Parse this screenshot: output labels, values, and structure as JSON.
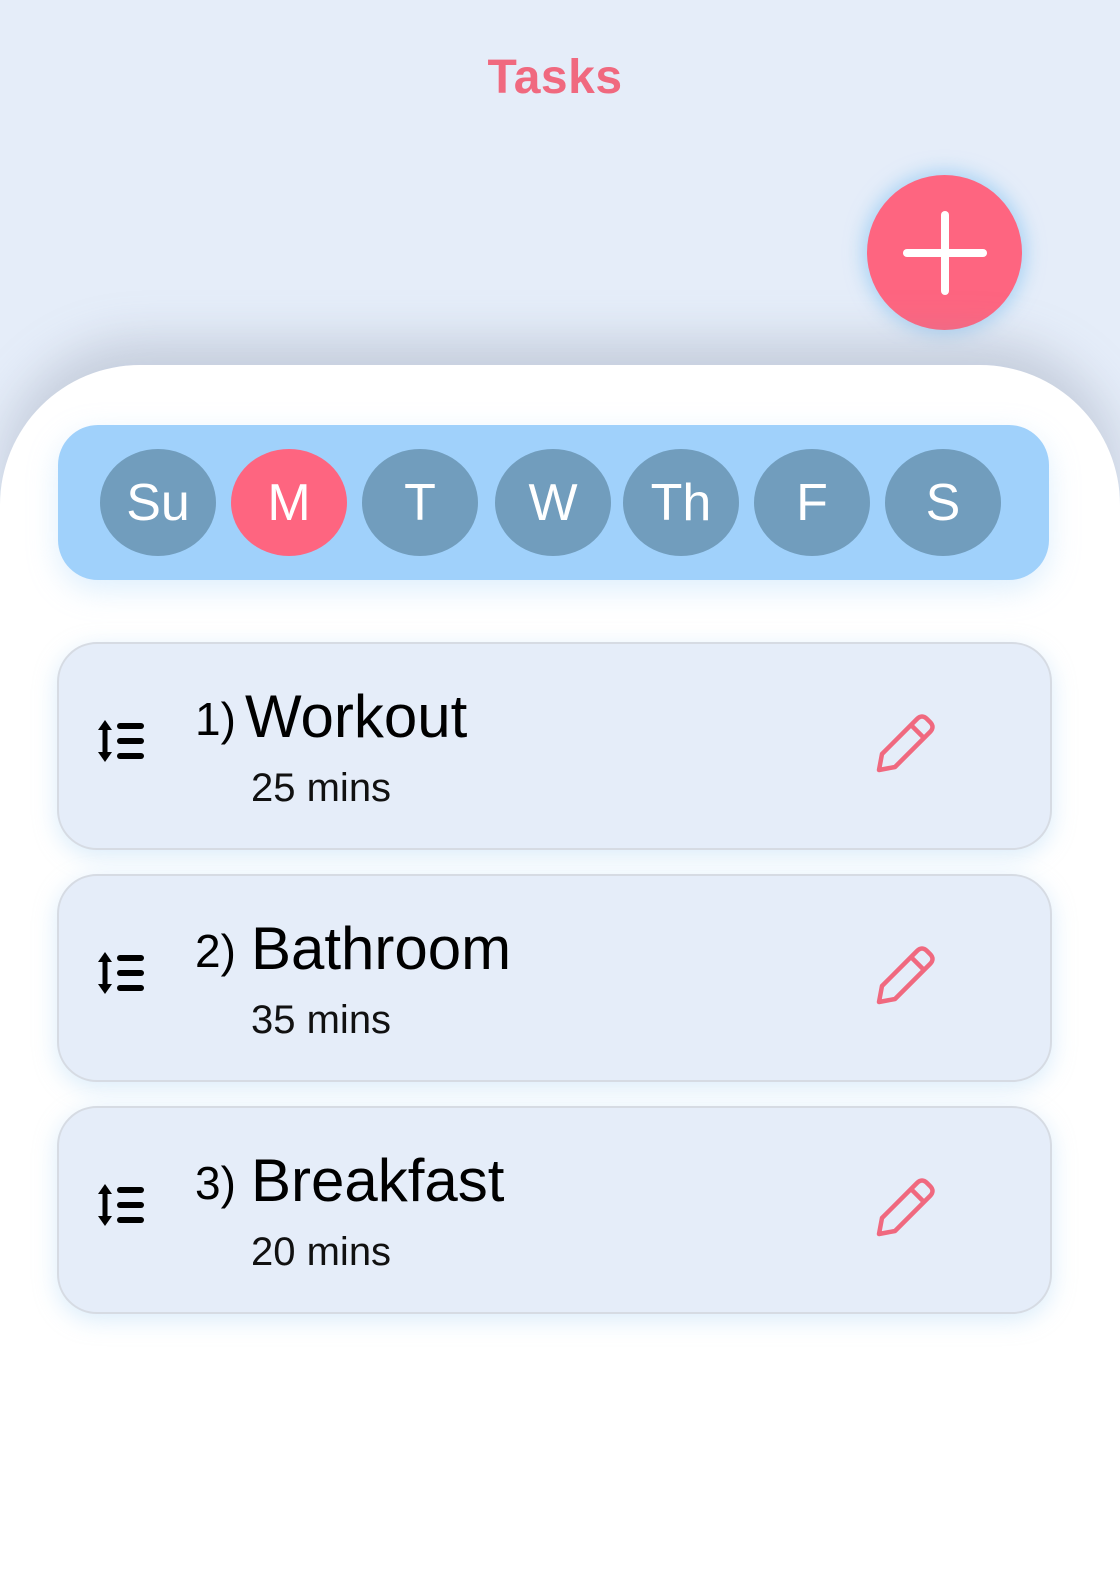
{
  "header": {
    "title": "Tasks"
  },
  "fab": {
    "icon": "plus-icon"
  },
  "days": [
    {
      "label": "Su",
      "active": false
    },
    {
      "label": "M",
      "active": true
    },
    {
      "label": "T",
      "active": false
    },
    {
      "label": "W",
      "active": false
    },
    {
      "label": "Th",
      "active": false
    },
    {
      "label": "F",
      "active": false
    },
    {
      "label": "S",
      "active": false
    }
  ],
  "tasks": [
    {
      "number": "1)",
      "name": "Workout",
      "duration": "25 mins"
    },
    {
      "number": "2)",
      "name": "Bathroom",
      "duration": "35 mins"
    },
    {
      "number": "3)",
      "name": "Breakfast",
      "duration": "20 mins"
    }
  ],
  "colors": {
    "accent": "#fe6580",
    "title": "#f0697f",
    "day_default": "#719dbd",
    "day_bar": "#a0d1fb",
    "background": "#e5edf9"
  }
}
